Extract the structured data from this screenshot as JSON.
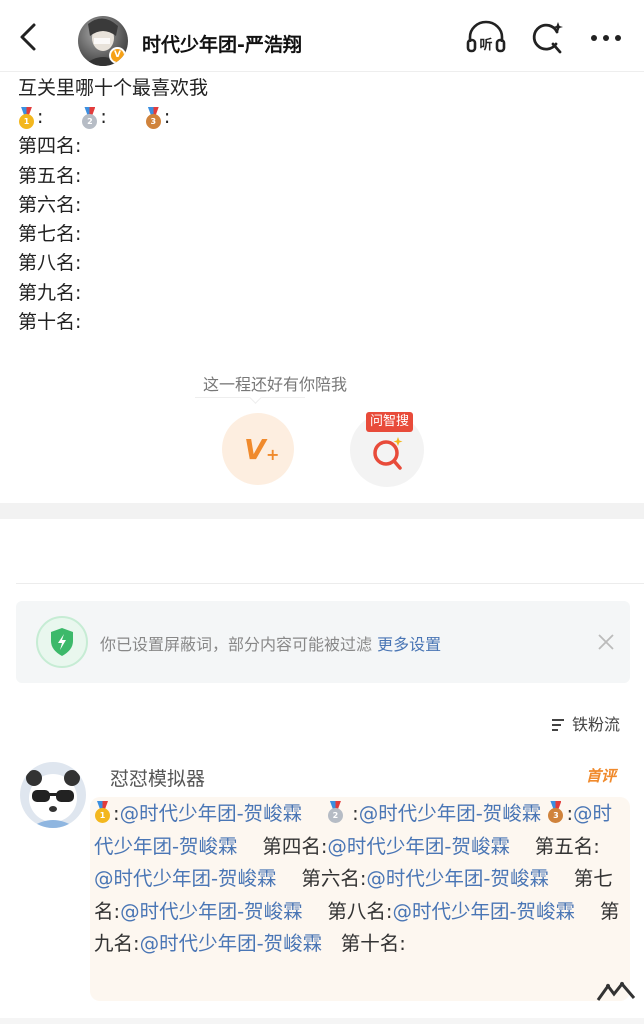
{
  "header": {
    "title": "时代少年团-严浩翔",
    "avatar_badge": "V",
    "icons": [
      "back-icon",
      "listen-icon",
      "ai-search-icon",
      "more-icon"
    ]
  },
  "post": {
    "line1": "互关里哪十个最喜欢我",
    "medal_sep": ":",
    "ranks": [
      "第四名:",
      "第五名:",
      "第六名:",
      "第七名:",
      "第八名:",
      "第九名:",
      "第十名:"
    ]
  },
  "actions": {
    "bubble_text": "这一程还好有你陪我",
    "vplus_text": "V",
    "vplus_plus": "+",
    "ask_label": "问智搜"
  },
  "notice": {
    "text": "你已设置屏蔽词，部分内容可能被过滤",
    "link": "更多设置"
  },
  "sort": {
    "label": "铁粉流"
  },
  "comment": {
    "user": "怼怼模拟器",
    "tag": "首评",
    "parts": [
      {
        "t": ":",
        "m": "@时代少年团-贺峻霖"
      },
      {
        "t": " :",
        "m": "@时代少年团-贺峻霖"
      },
      {
        "t": ":",
        "m": "@时代少年团-贺峻霖"
      },
      {
        "t": "第四名:",
        "m": "@时代少年团-贺峻霖"
      },
      {
        "t": "第五名: ",
        "m": "@时代少年团-贺峻霖"
      },
      {
        "t": "第六名:",
        "m": "@时代少年团-贺峻霖"
      },
      {
        "t": "第七名:",
        "m": "@时代少年团-贺峻霖"
      },
      {
        "t": "第八名:",
        "m": "@时代少年团-贺峻霖"
      },
      {
        "t": "第九名:",
        "m": "@时代少年团-贺峻霖"
      },
      {
        "t": "第十名:",
        "m": ""
      }
    ]
  },
  "colors": {
    "accent_orange": "#f08a2c",
    "link_blue": "#4a76b5",
    "ask_red": "#e84b3a"
  }
}
